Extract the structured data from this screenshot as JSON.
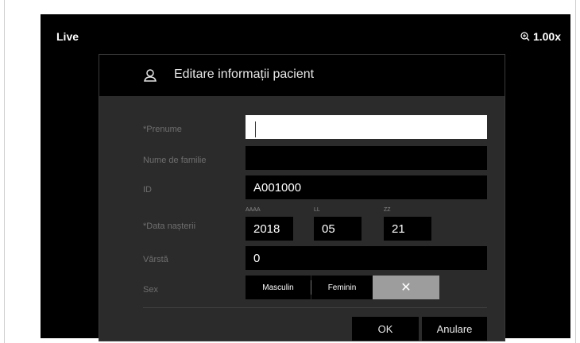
{
  "header": {
    "mode_label": "Live",
    "zoom_level": "1.00x"
  },
  "dialog": {
    "title": "Editare informații pacient",
    "fields": {
      "first_name": {
        "label": "*Prenume",
        "value": ""
      },
      "last_name": {
        "label": "Nume de familie",
        "value": ""
      },
      "id": {
        "label": "ID",
        "value": "A001000"
      },
      "birth_date": {
        "label": "*Data nașterii",
        "year_caption": "AAAA",
        "month_caption": "LL",
        "day_caption": "ZZ",
        "year": "2018",
        "month": "05",
        "day": "21"
      },
      "age": {
        "label": "Vârstă",
        "value": "0"
      },
      "sex": {
        "label": "Sex",
        "male": "Masculin",
        "female": "Feminin",
        "clear": "✕"
      }
    },
    "buttons": {
      "ok": "OK",
      "cancel": "Anulare"
    }
  }
}
